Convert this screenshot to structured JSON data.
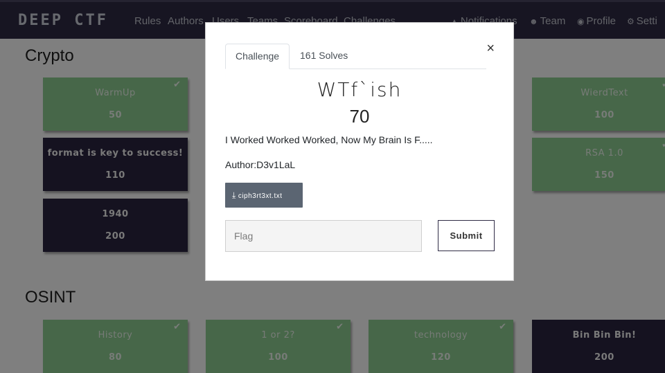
{
  "navbar": {
    "brand": "DEEP CTF",
    "links": [
      "Rules",
      "Authors",
      "Users",
      "Teams",
      "Scoreboard",
      "Challenges"
    ],
    "right": [
      {
        "icon": "bell-icon",
        "glyph": "▲",
        "label": "Notifications"
      },
      {
        "icon": "users-icon",
        "glyph": "☻",
        "label": "Team"
      },
      {
        "icon": "user-circle-icon",
        "glyph": "◉",
        "label": "Profile"
      },
      {
        "icon": "gears-icon",
        "glyph": "⚙",
        "label": "Setti"
      }
    ]
  },
  "categories": [
    {
      "title": "Crypto",
      "challenges": [
        {
          "name": "WarmUp",
          "value": "50",
          "solved": true
        },
        {
          "name": "format is key to success!",
          "value": "110",
          "solved": false
        },
        {
          "name": "1940",
          "value": "200",
          "solved": false
        },
        {
          "name": "WierdText",
          "value": "100",
          "solved": true
        },
        {
          "name": "RSA 1.0",
          "value": "150",
          "solved": true
        }
      ]
    },
    {
      "title": "OSINT",
      "challenges": [
        {
          "name": "History",
          "value": "80",
          "solved": true
        },
        {
          "name": "1 or 2?",
          "value": "100",
          "solved": true
        },
        {
          "name": "technology",
          "value": "120",
          "solved": true
        },
        {
          "name": "Bin Bin Bin!",
          "value": "200",
          "solved": false
        }
      ]
    }
  ],
  "modal": {
    "tabs": [
      "Challenge",
      "161 Solves"
    ],
    "close_glyph": "×",
    "name": "WTf`ish",
    "value": "70",
    "description": "I Worked Worked Worked, Now My Brain Is F.....",
    "author": "Author:D3v1LaL",
    "file": "ciph3rt3xt.txt",
    "flag_placeholder": "Flag",
    "submit_label": "Submit"
  },
  "colors": {
    "navbar": "#2f2b45",
    "solved": "#8fce93",
    "unsolved": "#2b2540",
    "file_button": "#5b6572"
  },
  "checkmark_glyph": "✔",
  "download_glyph": "⤓"
}
